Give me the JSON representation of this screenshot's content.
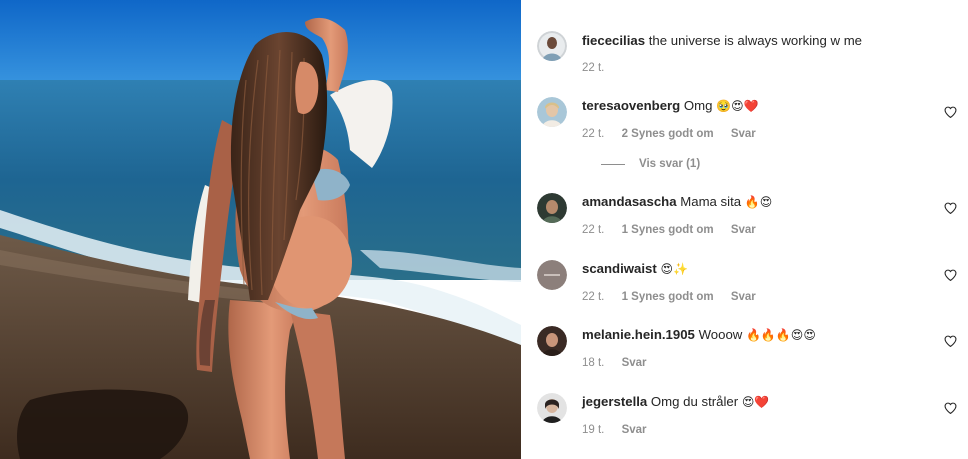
{
  "colors": {
    "text": "#262626",
    "muted": "#8e8e8e",
    "sky": "#1f78c4",
    "sea": "#1a5f8e",
    "sand": "#5b4636"
  },
  "photo": {
    "subject": "photo-of-woman-on-beach"
  },
  "caption": {
    "username": "fiececilias",
    "text": "the universe is always working w me",
    "time": "22 t."
  },
  "comments": [
    {
      "username": "teresaovenberg",
      "text": "Omg",
      "emoji": "🥹😍❤️",
      "time": "22 t.",
      "likes": "2 Synes godt om",
      "reply": "Svar",
      "view_replies": "Vis svar (1)"
    },
    {
      "username": "amandasascha",
      "text": "Mama sita",
      "emoji": "🔥😍",
      "time": "22 t.",
      "likes": "1 Synes godt om",
      "reply": "Svar"
    },
    {
      "username": "scandiwaist",
      "text": "",
      "emoji": "😍✨",
      "time": "22 t.",
      "likes": "1 Synes godt om",
      "reply": "Svar"
    },
    {
      "username": "melanie.hein.1905",
      "text": "Wooow",
      "emoji": "🔥🔥🔥😍😍",
      "time": "18 t.",
      "reply": "Svar"
    },
    {
      "username": "jegerstella",
      "text": "Omg du stråler",
      "emoji": "😍❤️",
      "time": "19 t.",
      "reply": "Svar"
    }
  ],
  "icons": {
    "like": "heart-outline-icon"
  }
}
